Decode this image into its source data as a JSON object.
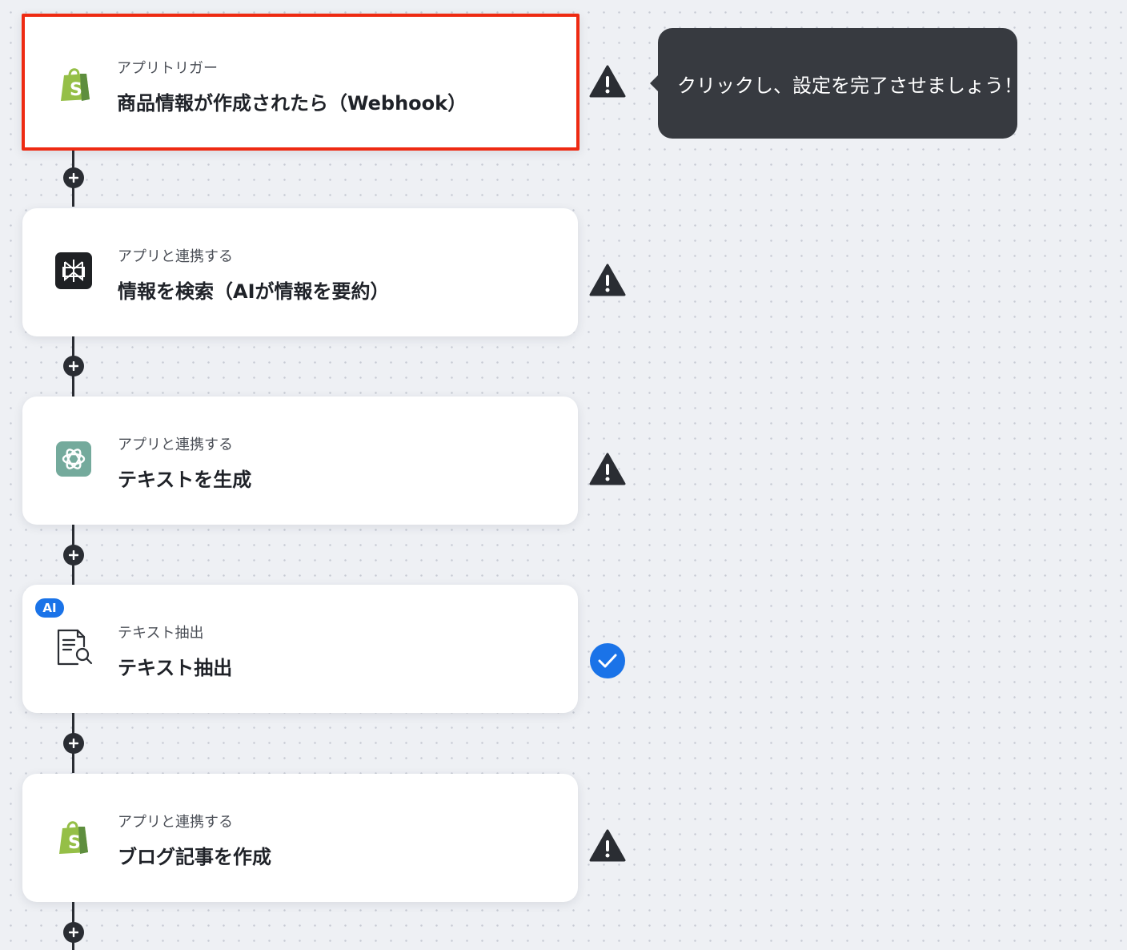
{
  "tooltip": {
    "text": "クリックし、設定を完了させましょう！"
  },
  "steps": [
    {
      "subtitle": "アプリトリガー",
      "title": "商品情報が作成されたら（Webhook）",
      "icon": "shopify-icon",
      "status": "warning",
      "selected": true
    },
    {
      "subtitle": "アプリと連携する",
      "title": "情報を検索（AIが情報を要約）",
      "icon": "perplexity-icon",
      "status": "warning"
    },
    {
      "subtitle": "アプリと連携する",
      "title": "テキストを生成",
      "icon": "chatgpt-icon",
      "status": "warning"
    },
    {
      "subtitle": "テキスト抽出",
      "title": "テキスト抽出",
      "icon": "document-search-icon",
      "status": "complete",
      "badge": "AI"
    },
    {
      "subtitle": "アプリと連携する",
      "title": "ブログ記事を作成",
      "icon": "shopify-icon",
      "status": "warning"
    }
  ],
  "colors": {
    "selected_border": "#ee2a12",
    "warning": "#2a2d33",
    "complete": "#1a73e8",
    "ai_badge": "#1a73e8",
    "shopify": "#95bf47",
    "chatgpt": "#74aa9c"
  }
}
